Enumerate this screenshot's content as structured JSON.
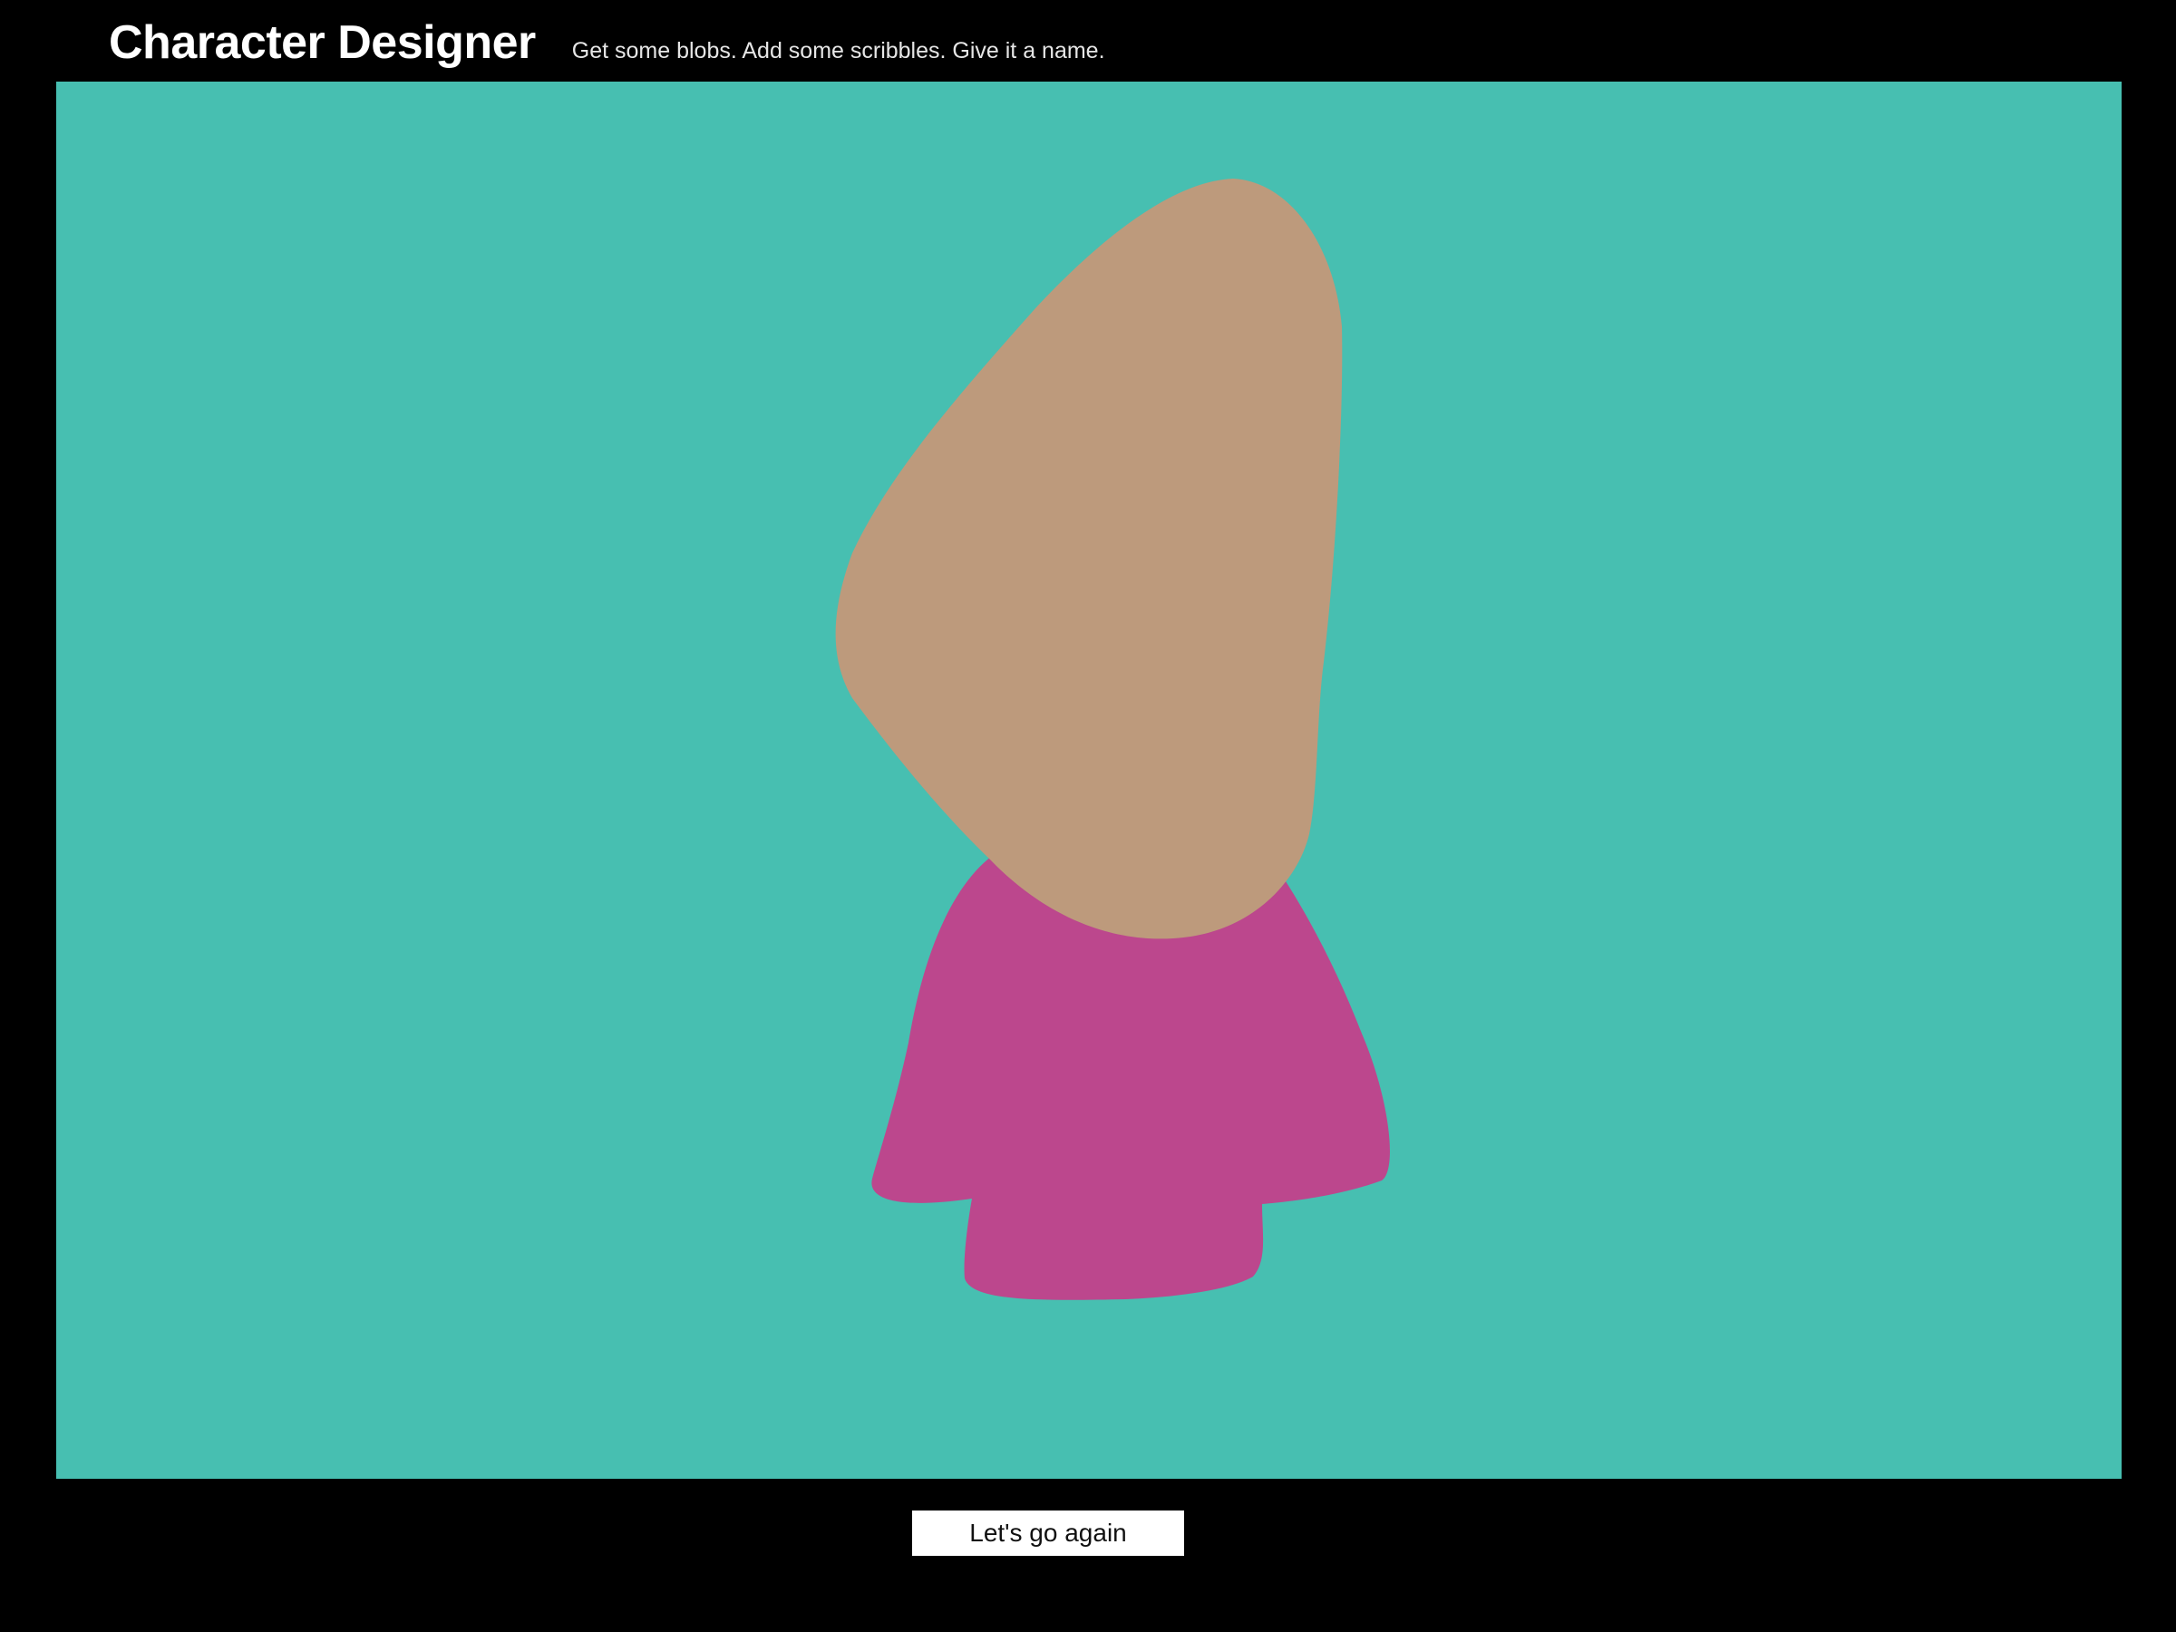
{
  "header": {
    "title": "Character Designer",
    "subtitle": "Get some blobs. Add some scribbles. Give it a name."
  },
  "canvas": {
    "background_color": "#47BFB1",
    "shapes": [
      {
        "name": "body-blob",
        "color": "#BC478D"
      },
      {
        "name": "head-blob",
        "color": "#BD9A7C"
      }
    ]
  },
  "actions": {
    "again_label": "Let's go again"
  },
  "colors": {
    "page_background": "#000000",
    "button_background": "#FFFFFF"
  }
}
